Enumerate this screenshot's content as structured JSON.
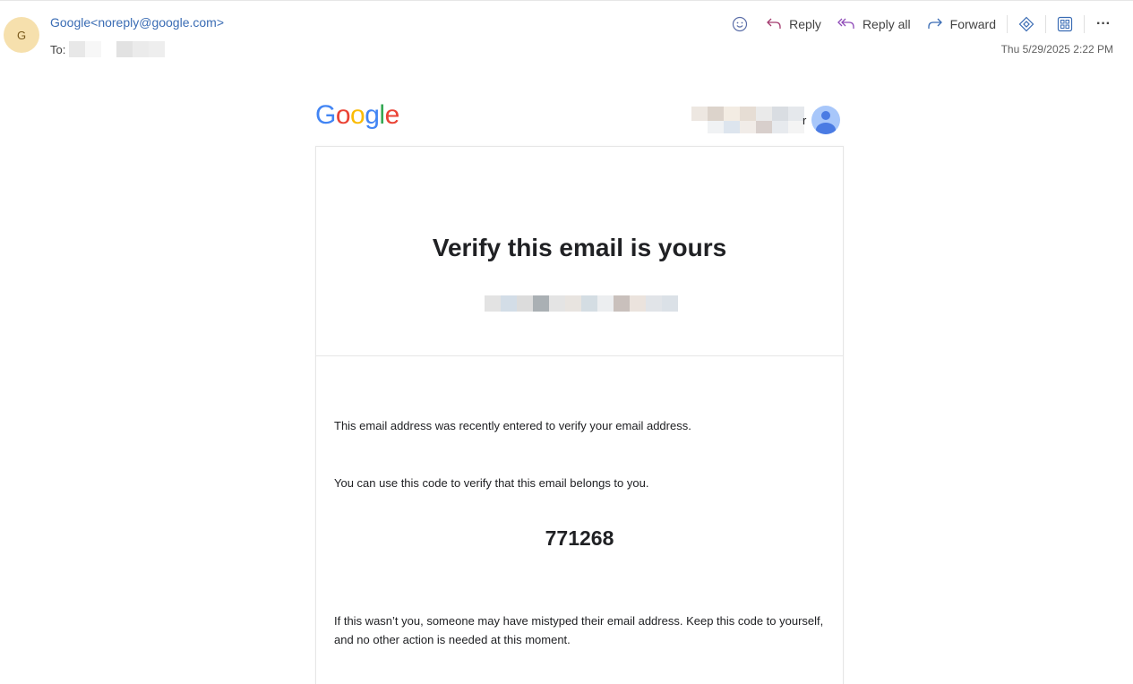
{
  "sender": {
    "avatar_initial": "G",
    "display": "Google<noreply@google.com>",
    "to_label": "To:"
  },
  "toolbar": {
    "emoji_icon": "smiley-icon",
    "reply_label": "Reply",
    "reply_all_label": "Reply all",
    "forward_label": "Forward",
    "more_label": "···"
  },
  "date": "Thu 5/29/2025 2:22 PM",
  "email": {
    "logo_text": "Google",
    "account_suffix": "r",
    "headline": "Verify this email is yours",
    "para1": "This email address was recently entered to verify your email address.",
    "para2": "You can use this code to verify that this email belongs to you.",
    "code": "771268",
    "para3": "If this wasn’t you, someone may have mistyped their email address. Keep this code to yourself, and no other action is needed at this moment."
  },
  "colors": {
    "link_blue": "#3a6cb4",
    "avatar_bg": "#f6e0ad",
    "reply_all_purple": "#8f4bb8",
    "google_blue": "#4285F4",
    "google_red": "#EA4335",
    "google_yellow": "#FBBC05",
    "google_green": "#34A853"
  }
}
